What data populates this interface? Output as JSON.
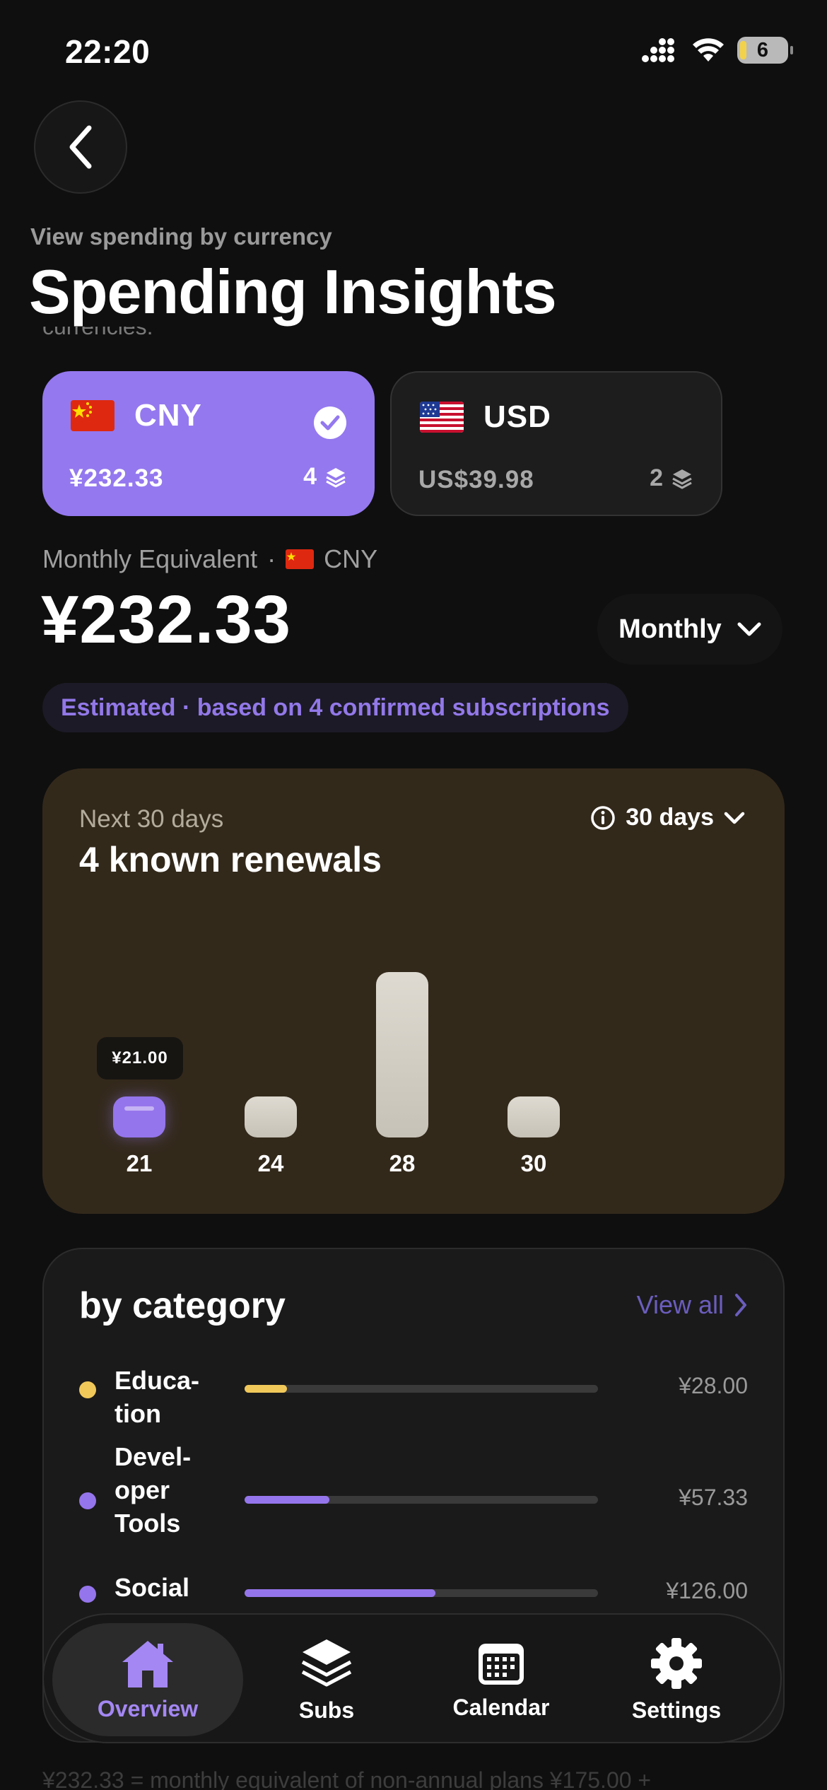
{
  "status": {
    "time": "22:20",
    "battery": "6"
  },
  "header": {
    "subtitle": "View spending by currency",
    "title": "Spending Insights",
    "clipped_text": "currencies:"
  },
  "currencies": [
    {
      "code": "CNY",
      "amount": "¥232.33",
      "count": "4",
      "selected": true
    },
    {
      "code": "USD",
      "amount": "US$39.98",
      "count": "2",
      "selected": false
    }
  ],
  "summary": {
    "label": "Monthly Equivalent",
    "separator": "·",
    "currency": "CNY",
    "amount": "¥232.33",
    "period": "Monthly",
    "estimate_badge": "Estimated · based on 4 confirmed subscriptions"
  },
  "renewals": {
    "label": "Next 30 days",
    "title": "4 known renewals",
    "range": "30 days",
    "tooltip": "¥21.00",
    "bars": [
      {
        "day": "21",
        "relative_amount": 0.21,
        "selected": true
      },
      {
        "day": "24",
        "relative_amount": 0.21,
        "selected": false
      },
      {
        "day": "28",
        "relative_amount": 1.0,
        "selected": false
      },
      {
        "day": "30",
        "relative_amount": 0.21,
        "selected": false
      }
    ]
  },
  "category": {
    "title": "by category",
    "view_all": "View all",
    "items": [
      {
        "name": "Educa-\ntion",
        "value": "¥28.00",
        "color": "#f0c85a",
        "share": 0.12
      },
      {
        "name": "Devel-\noper\nTools",
        "value": "¥57.33",
        "color": "#9575ec",
        "share": 0.24
      },
      {
        "name": "Social",
        "value": "¥126.00",
        "color": "#9575ec",
        "share": 0.54
      }
    ]
  },
  "tabs": [
    {
      "label": "Overview",
      "icon": "house-icon",
      "active": true
    },
    {
      "label": "Subs",
      "icon": "stack-icon",
      "active": false
    },
    {
      "label": "Calendar",
      "icon": "calendar-icon",
      "active": false
    },
    {
      "label": "Settings",
      "icon": "gear-icon",
      "active": false
    }
  ],
  "footnote": "¥232.33 = monthly equivalent of non-annual plans ¥175.00 +"
}
